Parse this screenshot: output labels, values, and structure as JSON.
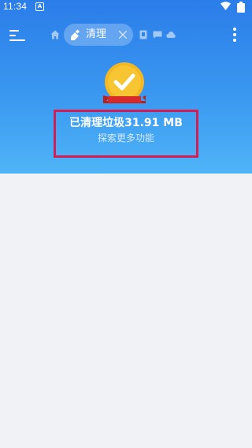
{
  "status_bar": {
    "time": "11:34",
    "notification_letter": "A",
    "wifi_icon": "wifi-icon",
    "battery_icon": "battery-icon"
  },
  "toolbar": {
    "menu_icon": "menu-icon",
    "home_icon": "home-icon",
    "active_tab": {
      "icon": "broom-icon",
      "label": "清理",
      "close_icon": "close-icon"
    },
    "mini_tabs": [
      "file-icon",
      "chat-icon",
      "cloud-icon"
    ],
    "overflow_icon": "more-vertical-icon"
  },
  "result": {
    "title": "已清理垃圾31.91 MB",
    "link": "探索更多功能",
    "badge_icon": "checkmark-badge-icon"
  },
  "colors": {
    "header_top": "#2b7de9",
    "header_bottom": "#4fb4f7",
    "highlight_border": "#d41c55",
    "badge_gold": "#f7c531",
    "ribbon_red": "#d92a2a",
    "background": "#f1f2f6"
  }
}
